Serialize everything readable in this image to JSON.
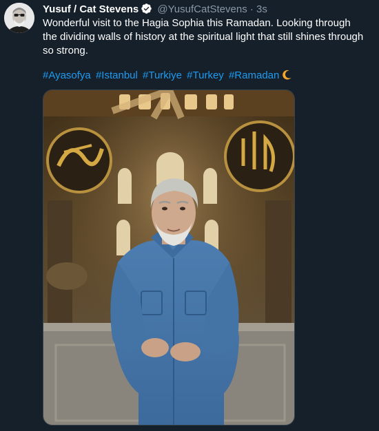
{
  "tweet": {
    "author_name": "Yusuf / Cat Stevens",
    "handle": "@YusufCatStevens",
    "separator": "·",
    "timestamp": "3s",
    "text": "Wonderful visit to the Hagia Sophia this Ramadan. Looking through the dividing walls of history at the spiritual light that still shines through so strong.",
    "hashtags": [
      "#Ayasofya",
      "#Istanbul",
      "#Turkiye",
      "#Turkey",
      "#Ramadan"
    ],
    "trailing_emoji_icon": "crescent-moon-icon",
    "verified_icon": "verified-badge-icon"
  },
  "colors": {
    "background": "#15202b",
    "text": "#ffffff",
    "secondary_text": "#8b98a5",
    "link": "#1d9bf0",
    "verified": "#ffffff",
    "moon": "#f4a62a"
  },
  "media": {
    "image_icon": "photo-man-hagia-sophia"
  }
}
